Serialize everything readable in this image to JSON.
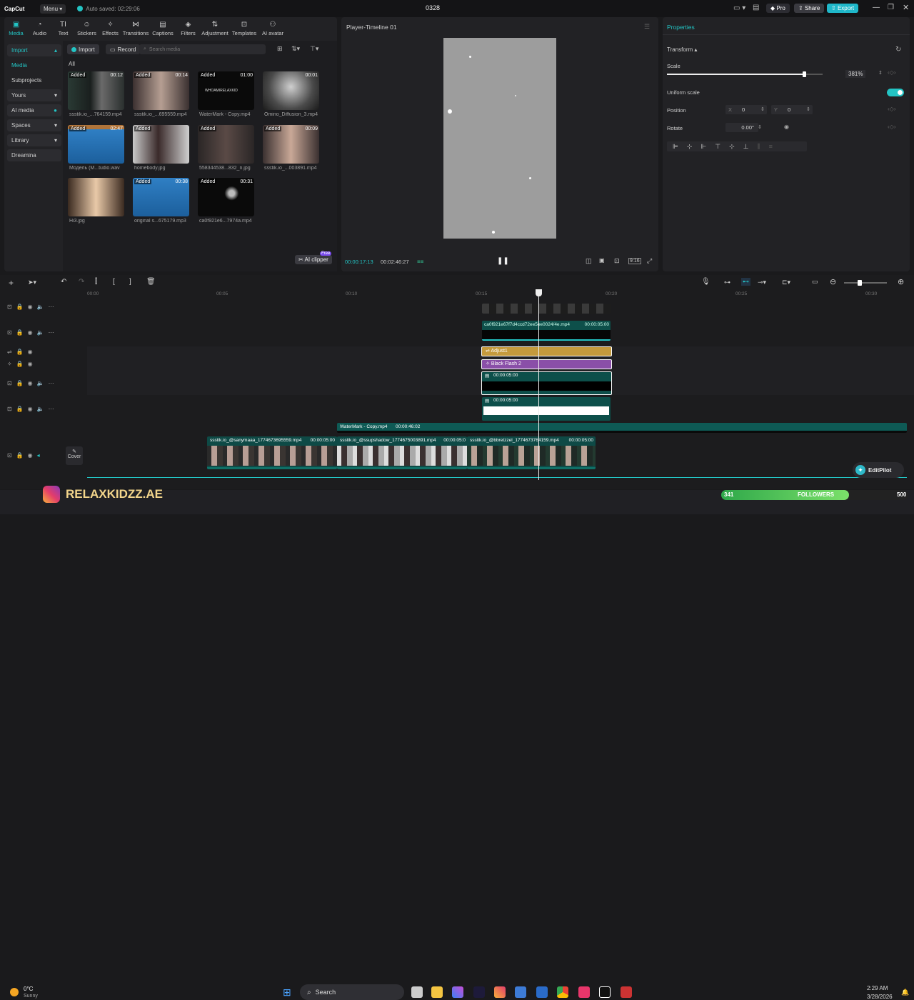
{
  "topbar": {
    "logo": "CapCut",
    "menu": "Menu",
    "autosave": "Auto saved: 02:29:06",
    "project_title": "0328",
    "pro": "Pro",
    "share": "Share",
    "export": "Export"
  },
  "toolbar": {
    "tabs": [
      {
        "label": "Media",
        "icon": "▣"
      },
      {
        "label": "Audio",
        "icon": "◔"
      },
      {
        "label": "Text",
        "icon": "TI"
      },
      {
        "label": "Stickers",
        "icon": "☺"
      },
      {
        "label": "Effects",
        "icon": "✧"
      },
      {
        "label": "Transitions",
        "icon": "⋈"
      },
      {
        "label": "Captions",
        "icon": "▤"
      },
      {
        "label": "Filters",
        "icon": "◈"
      },
      {
        "label": "Adjustment",
        "icon": "⇅"
      },
      {
        "label": "Templates",
        "icon": "⊡"
      },
      {
        "label": "AI avatar",
        "icon": "⚇"
      }
    ]
  },
  "sidebar": {
    "items": [
      {
        "label": "Import"
      },
      {
        "label": "Media"
      },
      {
        "label": "Subprojects"
      },
      {
        "label": "Yours"
      },
      {
        "label": "AI media"
      },
      {
        "label": "Spaces"
      },
      {
        "label": "Library"
      },
      {
        "label": "Dreamina"
      }
    ]
  },
  "media": {
    "import_btn": "Import",
    "record_btn": "Record",
    "search_placeholder": "Search media",
    "filter_all": "All",
    "ai_clipper": "AI clipper",
    "free_badge": "Free",
    "items": [
      {
        "added": "Added",
        "duration": "00:12",
        "name": "ssstik.io_...764159.mp4"
      },
      {
        "added": "Added",
        "duration": "00:14",
        "name": "ssstik.io_...695559.mp4"
      },
      {
        "added": "Added",
        "duration": "01:00",
        "name": "WaterMark - Copy.mp4",
        "overlay": "WHOAMIRELAXKID"
      },
      {
        "added": "",
        "duration": "00:01",
        "name": "Omino_Diffusion_3.mp4"
      },
      {
        "added": "Added",
        "duration": "02:47",
        "name": "Модель (M...tudio.wav"
      },
      {
        "added": "Added",
        "duration": "",
        "name": "homebody.jpg"
      },
      {
        "added": "Added",
        "duration": "",
        "name": "558344538...832_n.jpg"
      },
      {
        "added": "Added",
        "duration": "00:09",
        "name": "ssstik.io_...003891.mp4"
      },
      {
        "added": "",
        "duration": "",
        "name": "Hi3.jpg"
      },
      {
        "added": "Added",
        "duration": "00:38",
        "name": "original s...675179.mp3"
      },
      {
        "added": "Added",
        "duration": "00:31",
        "name": "ca0f921e6...7974a.mp4"
      }
    ]
  },
  "player": {
    "title": "Player-Timeline 01",
    "current_time": "00:00:17:13",
    "total_time": "00:02:46:27",
    "ratio": "9:16"
  },
  "properties": {
    "title": "Properties",
    "transform": "Transform",
    "scale_label": "Scale",
    "scale_value": "381%",
    "scale_fraction": 0.88,
    "uniform_scale": "Uniform scale",
    "position_label": "Position",
    "x_label": "X",
    "x_value": "0",
    "y_label": "Y",
    "y_value": "0",
    "rotate_label": "Rotate",
    "rotate_value": "0.00°"
  },
  "timeline": {
    "ruler": [
      "00:00",
      "00:05",
      "00:10",
      "00:15",
      "00:20",
      "00:25",
      "00:30"
    ],
    "cover": "Cover",
    "clips": {
      "ca0": "ca0f921e67f7d4ccd72ee5ee0024/4e.mp4",
      "ca0_dur": "00:00:05:00",
      "adjust": "Adjust1",
      "blackflash": "Black Flash 2",
      "black_dur": "00:00:05:00",
      "white_dur": "00:00:05:00",
      "watermark": "WaterMark - Copy.mp4",
      "watermark_dur": "00:00:46:02",
      "main1": "ssstik.io_@sanymaaa_1774673695559.mp4",
      "main1_dur": "00:00:05:00",
      "main2": "ssstik.io_@ssupshadow_1774675003891.mp4",
      "main2_dur": "00:00:05:0",
      "main3": "ssstik.io_@bbretzzel_1774673764159.mp4",
      "main3_dur": "00:00:05:00"
    },
    "editpilot": "EditPilot"
  },
  "overlay": {
    "brand": "RELAXKIDZZ.AE",
    "followers_label": "FOLLOWERS",
    "followers_count": "341",
    "followers_goal": "500",
    "followers_fraction": 0.682
  },
  "taskbar": {
    "temp": "0°C",
    "weather": "Sunny",
    "search": "Search",
    "time": "2:29 AM",
    "date": "3/28/2026"
  }
}
